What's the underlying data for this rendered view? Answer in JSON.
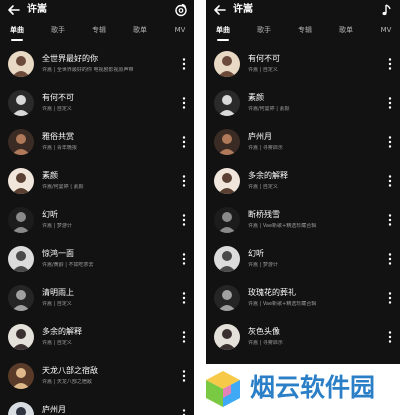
{
  "left": {
    "title": "许嵩",
    "action_icon": "fm-radio-icon",
    "tabs": [
      "单曲",
      "歌手",
      "专辑",
      "歌单",
      "MV"
    ],
    "active_tab": 0,
    "songs": [
      {
        "title": "全世界最好的你",
        "sub": "许嵩 | 全世界最好的你 电视剧影视原声带"
      },
      {
        "title": "有何不可",
        "sub": "许嵩 | 自定义"
      },
      {
        "title": "雅俗共赏",
        "sub": "许嵩 | 青年晚报"
      },
      {
        "title": "素颜",
        "sub": "许嵩/何曼婷 | 素颜"
      },
      {
        "title": "幻听",
        "sub": "许嵩 | 梦游计"
      },
      {
        "title": "惊鸿一面",
        "sub": "许嵩/黄龄 | 不如吃茶去"
      },
      {
        "title": "清明雨上",
        "sub": "许嵩 | 自定义"
      },
      {
        "title": "多余的解释",
        "sub": "许嵩 | 自定义"
      },
      {
        "title": "天龙八部之宿敌",
        "sub": "许嵩 | 天龙八部之宿敌"
      },
      {
        "title": "庐州月",
        "sub": "许嵩 | 寻雾启示"
      }
    ]
  },
  "right": {
    "title": "许嵩",
    "action_icon": "music-note-icon",
    "tabs": [
      "单曲",
      "歌手",
      "专辑",
      "歌单",
      "MV"
    ],
    "active_tab": 0,
    "songs": [
      {
        "title": "有何不可",
        "sub": "许嵩 | 自定义"
      },
      {
        "title": "素颜",
        "sub": "许嵩/何曼婷 | 素颜"
      },
      {
        "title": "庐州月",
        "sub": "许嵩 | 寻雾启示"
      },
      {
        "title": "多余的解释",
        "sub": "许嵩 | 自定义"
      },
      {
        "title": "断桥残雪",
        "sub": "许嵩 | Vae新歌+精选珍藏合辑"
      },
      {
        "title": "幻听",
        "sub": "许嵩 | 梦游计"
      },
      {
        "title": "玫瑰花的葬礼",
        "sub": "许嵩 | Vae新歌+精选珍藏合辑"
      },
      {
        "title": "灰色头像",
        "sub": "许嵩 | 寻雾启示"
      }
    ]
  },
  "watermark": {
    "text": "烟云软件园"
  },
  "colors": {
    "background": "#121212",
    "text": "#ffffff",
    "secondary_text": "#9a9a9a",
    "watermark": "#2b7fc7"
  }
}
